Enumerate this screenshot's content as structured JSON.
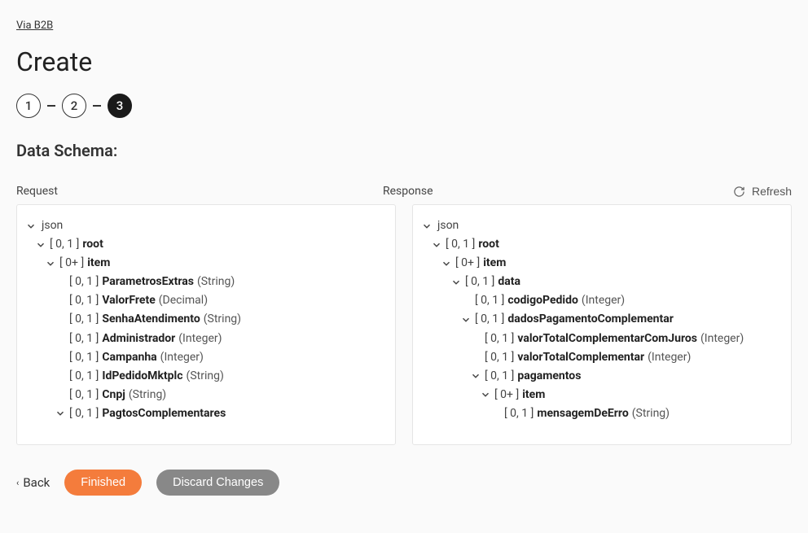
{
  "breadcrumb": "Via B2B",
  "pageTitle": "Create",
  "stepper": [
    "1",
    "2",
    "3"
  ],
  "activeStep": 2,
  "sectionTitle": "Data Schema:",
  "requestLabel": "Request",
  "responseLabel": "Response",
  "refreshLabel": "Refresh",
  "jsonLabel": "json",
  "ranges": {
    "r01": "[ 0, 1 ]",
    "r0plus": "[ 0+ ]"
  },
  "requestSchema": [
    {
      "indent": 0,
      "chevron": true,
      "label": "json",
      "isRoot": true
    },
    {
      "indent": 1,
      "chevron": true,
      "range": "r01",
      "name": "root"
    },
    {
      "indent": 2,
      "chevron": true,
      "range": "r0plus",
      "name": "item"
    },
    {
      "indent": 3,
      "chevron": false,
      "range": "r01",
      "name": "ParametrosExtras",
      "type": "(String)"
    },
    {
      "indent": 3,
      "chevron": false,
      "range": "r01",
      "name": "ValorFrete",
      "type": "(Decimal)"
    },
    {
      "indent": 3,
      "chevron": false,
      "range": "r01",
      "name": "SenhaAtendimento",
      "type": "(String)"
    },
    {
      "indent": 3,
      "chevron": false,
      "range": "r01",
      "name": "Administrador",
      "type": "(Integer)"
    },
    {
      "indent": 3,
      "chevron": false,
      "range": "r01",
      "name": "Campanha",
      "type": "(Integer)"
    },
    {
      "indent": 3,
      "chevron": false,
      "range": "r01",
      "name": "IdPedidoMktplc",
      "type": "(String)"
    },
    {
      "indent": 3,
      "chevron": false,
      "range": "r01",
      "name": "Cnpj",
      "type": "(String)"
    },
    {
      "indent": 3,
      "chevron": true,
      "range": "r01",
      "name": "PagtosComplementares"
    }
  ],
  "responseSchema": [
    {
      "indent": 0,
      "chevron": true,
      "label": "json",
      "isRoot": true
    },
    {
      "indent": 1,
      "chevron": true,
      "range": "r01",
      "name": "root"
    },
    {
      "indent": 2,
      "chevron": true,
      "range": "r0plus",
      "name": "item"
    },
    {
      "indent": 3,
      "chevron": true,
      "range": "r01",
      "name": "data"
    },
    {
      "indent": 4,
      "chevron": false,
      "range": "r01",
      "name": "codigoPedido",
      "type": "(Integer)"
    },
    {
      "indent": 4,
      "chevron": true,
      "range": "r01",
      "name": "dadosPagamentoComplementar"
    },
    {
      "indent": 5,
      "chevron": false,
      "range": "r01",
      "name": "valorTotalComplementarComJuros",
      "type": "(Integer)"
    },
    {
      "indent": 5,
      "chevron": false,
      "range": "r01",
      "name": "valorTotalComplementar",
      "type": "(Integer)"
    },
    {
      "indent": 5,
      "chevron": true,
      "range": "r01",
      "name": "pagamentos"
    },
    {
      "indent": 6,
      "chevron": true,
      "range": "r0plus",
      "name": "item"
    },
    {
      "indent": 7,
      "chevron": false,
      "range": "r01",
      "name": "mensagemDeErro",
      "type": "(String)"
    }
  ],
  "backLabel": "Back",
  "finishedLabel": "Finished",
  "discardLabel": "Discard Changes"
}
